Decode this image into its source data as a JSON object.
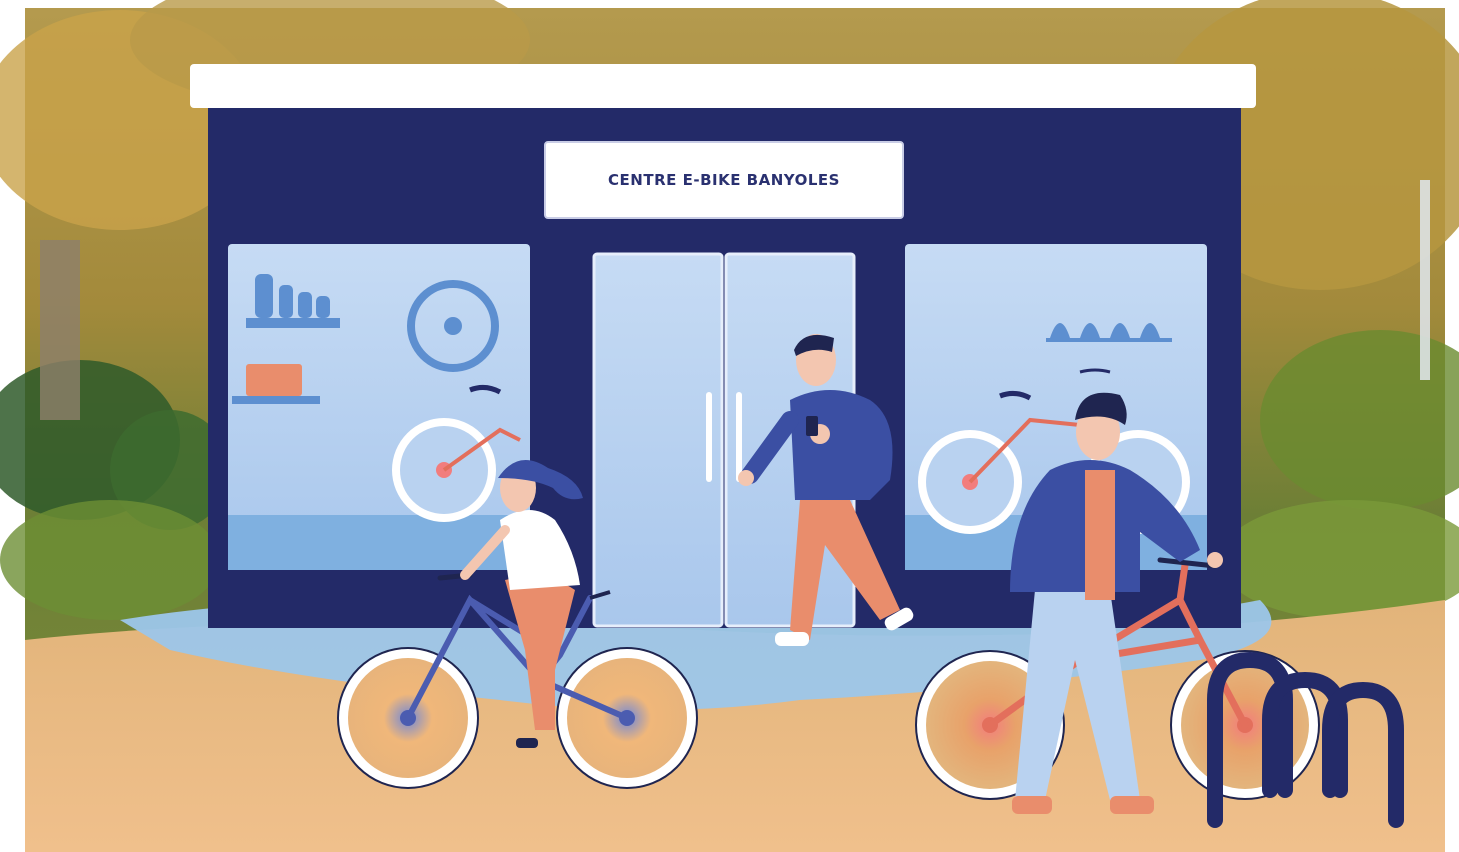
{
  "illustration": {
    "shop_sign": "CENTRE E-BIKE BANYOLES"
  },
  "colors": {
    "facade": "#232a68",
    "window_glass": "#b7d0ef",
    "window_glass_dark": "#7fb0e0",
    "path_water_blue": "#9cc6ea",
    "ground_sand": "#e3b57d",
    "foliage_green": "#6f8a3a",
    "foliage_gold": "#c8a247",
    "person_blue": "#3b4fa3",
    "person_salmon": "#e98d6c",
    "skin": "#f3c6b0",
    "hair": "#1f2550",
    "wheel_white": "#ffffff",
    "bike_frame_red": "#e36f5c",
    "bike_frame_blue": "#4b5cb0",
    "rack_navy": "#232a68"
  },
  "icons": [
    "shelf-bottles-icon",
    "wheel-display-icon",
    "toolbox-icon",
    "pendant-lamps-icon",
    "bicycle-icon",
    "bike-rack-icon",
    "door-handles-icon",
    "smartphone-icon"
  ]
}
